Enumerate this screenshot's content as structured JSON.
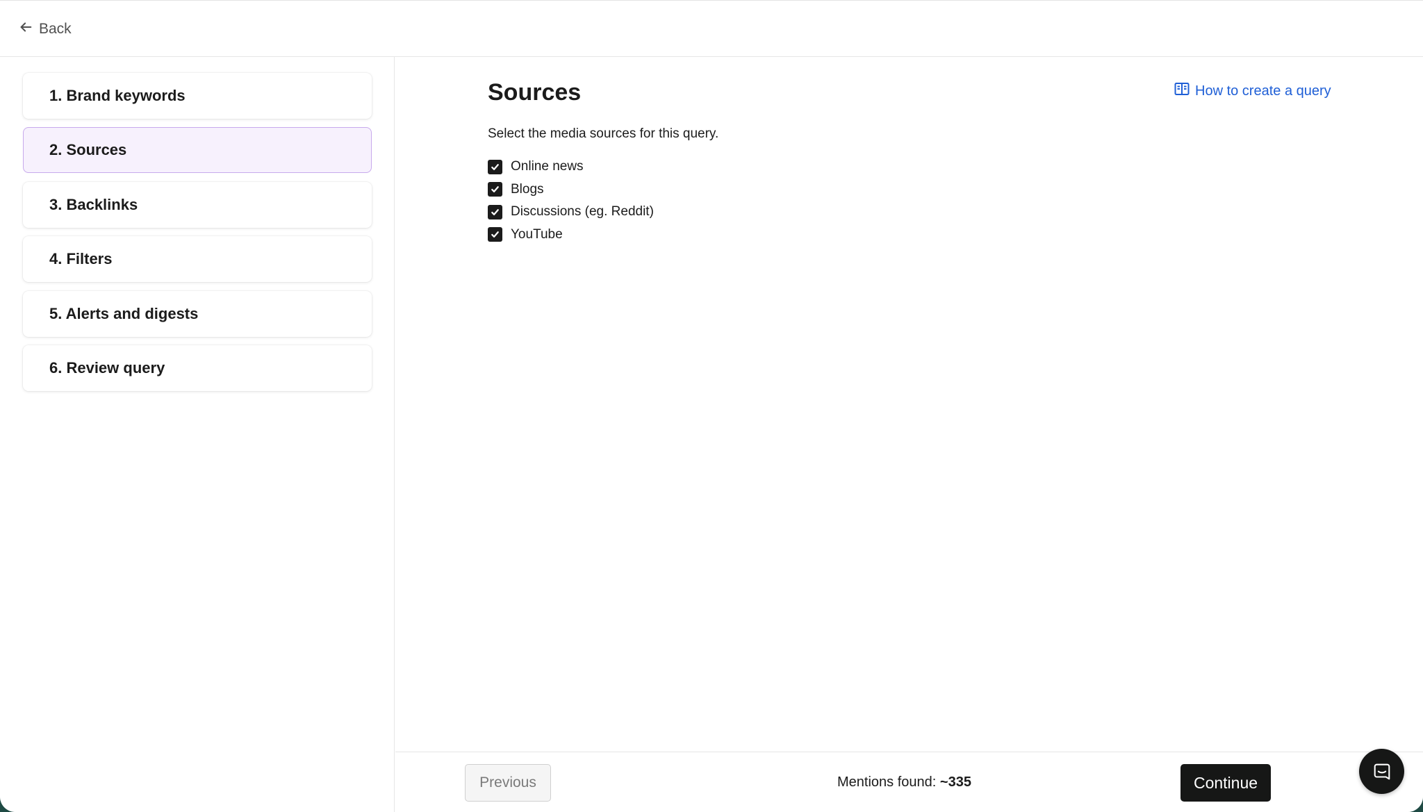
{
  "header": {
    "back_label": "Back"
  },
  "sidebar": {
    "steps": [
      {
        "label": "1. Brand keywords",
        "active": false
      },
      {
        "label": "2. Sources",
        "active": true
      },
      {
        "label": "3. Backlinks",
        "active": false
      },
      {
        "label": "4. Filters",
        "active": false
      },
      {
        "label": "5. Alerts and digests",
        "active": false
      },
      {
        "label": "6. Review query",
        "active": false
      }
    ]
  },
  "main": {
    "title": "Sources",
    "help_link": "How to create a query",
    "description": "Select the media sources for this query.",
    "sources": [
      {
        "label": "Online news",
        "checked": true
      },
      {
        "label": "Blogs",
        "checked": true
      },
      {
        "label": "Discussions (eg. Reddit)",
        "checked": true
      },
      {
        "label": "YouTube",
        "checked": true
      }
    ]
  },
  "footer": {
    "previous_label": "Previous",
    "mentions_label": "Mentions found:",
    "mentions_value": "~335",
    "continue_label": "Continue"
  },
  "colors": {
    "active_step_bg": "#f7f1fd",
    "active_step_border": "#c7a9ec",
    "link": "#1f5fd6",
    "primary_button": "#161716"
  },
  "icons": {
    "back": "arrow-left-icon",
    "help": "open-book-icon",
    "checkbox": "check-icon",
    "chat": "chat-icon"
  }
}
